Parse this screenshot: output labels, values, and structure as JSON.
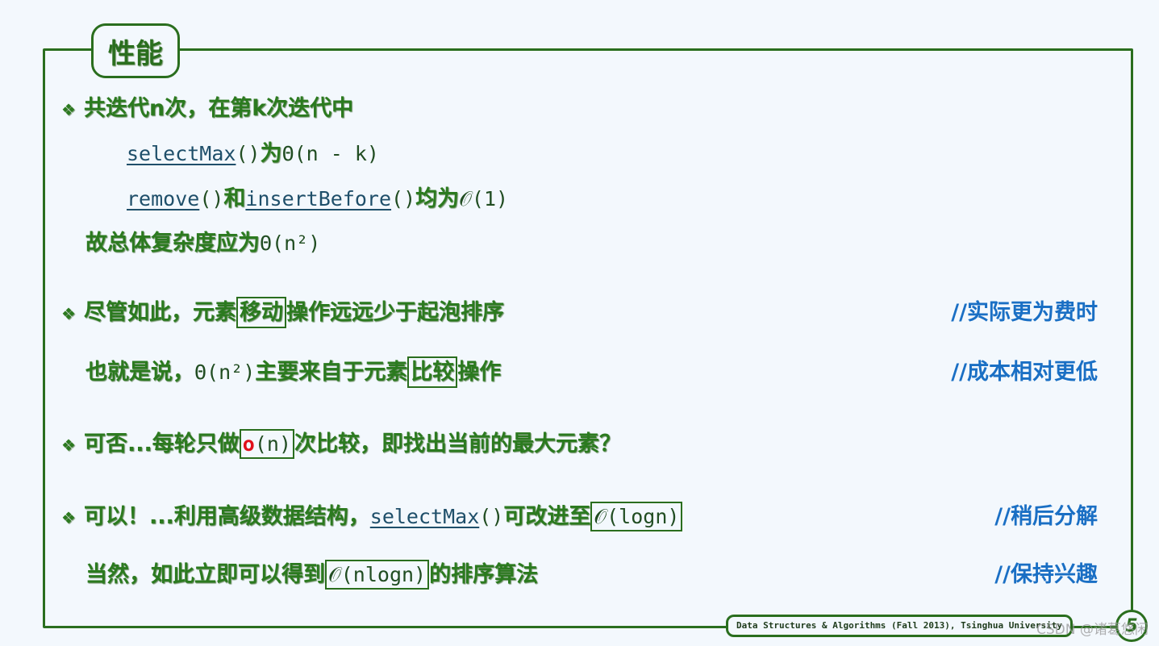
{
  "slide": {
    "title": "性能",
    "footer": "Data Structures & Algorithms (Fall 2013), Tsinghua University",
    "page_number": "5",
    "watermark": "CSDN @诸葛悠闲",
    "colors": {
      "text": "#2b7a1f",
      "frame": "#2a6e1e",
      "comment": "#1a6fc4",
      "code": "#1f4f6a",
      "highlight": "#e0101a",
      "background": "#f3f8fd"
    },
    "bullet_icon": "diamond-bullet-icon",
    "lines": [
      {
        "bullet": true,
        "segments": [
          {
            "t": "共迭代n次，在第k次迭代中",
            "s": "cn"
          }
        ]
      },
      {
        "indent": 2,
        "segments": [
          {
            "t": "selectMax",
            "s": "code"
          },
          {
            "t": "()",
            "s": "math"
          },
          {
            "t": "为",
            "s": "cn"
          },
          {
            "t": "Θ(n - k)",
            "s": "math"
          }
        ]
      },
      {
        "indent": 2,
        "segments": [
          {
            "t": "remove",
            "s": "code"
          },
          {
            "t": "()",
            "s": "math"
          },
          {
            "t": "和",
            "s": "cn"
          },
          {
            "t": "insertBefore",
            "s": "code"
          },
          {
            "t": "()",
            "s": "math"
          },
          {
            "t": "均为",
            "s": "cn"
          },
          {
            "t": "𝒪(1)",
            "s": "math"
          }
        ]
      },
      {
        "indent": 1,
        "segments": [
          {
            "t": "故总体复杂度应为",
            "s": "cn"
          },
          {
            "t": "Θ(n²)",
            "s": "math"
          }
        ]
      },
      {
        "bullet": true,
        "comment": "//实际更为费时",
        "segments": [
          {
            "t": "尽管如此，元素",
            "s": "cn"
          },
          {
            "t": "移动",
            "s": "box"
          },
          {
            "t": "操作远远少于起泡排序",
            "s": "cn"
          }
        ]
      },
      {
        "indent": 1,
        "comment": "//成本相对更低",
        "segments": [
          {
            "t": "也就是说，",
            "s": "cn"
          },
          {
            "t": "Θ(n²)",
            "s": "math"
          },
          {
            "t": "主要来自于元素",
            "s": "cn"
          },
          {
            "t": "比较",
            "s": "box"
          },
          {
            "t": "操作",
            "s": "cn"
          }
        ]
      },
      {
        "bullet": true,
        "segments": [
          {
            "t": "可否...每轮只做",
            "s": "cn"
          },
          {
            "t": "o",
            "s": "boxred"
          },
          {
            "t": "(n)",
            "s": "boxmathend"
          },
          {
            "t": "次比较，即找出当前的最大元素？",
            "s": "cn"
          }
        ]
      },
      {
        "bullet": true,
        "comment": "//稍后分解",
        "segments": [
          {
            "t": "可以！...利用高级数据结构，",
            "s": "cn"
          },
          {
            "t": "selectMax",
            "s": "code"
          },
          {
            "t": "()",
            "s": "math"
          },
          {
            "t": "可改进至",
            "s": "cn"
          },
          {
            "t": "𝒪(logn)",
            "s": "boxmath"
          }
        ]
      },
      {
        "indent": 1,
        "comment": "//保持兴趣",
        "segments": [
          {
            "t": "当然，如此立即可以得到",
            "s": "cn"
          },
          {
            "t": "𝒪(nlogn)",
            "s": "boxmath"
          },
          {
            "t": "的排序算法",
            "s": "cn"
          }
        ]
      }
    ]
  }
}
